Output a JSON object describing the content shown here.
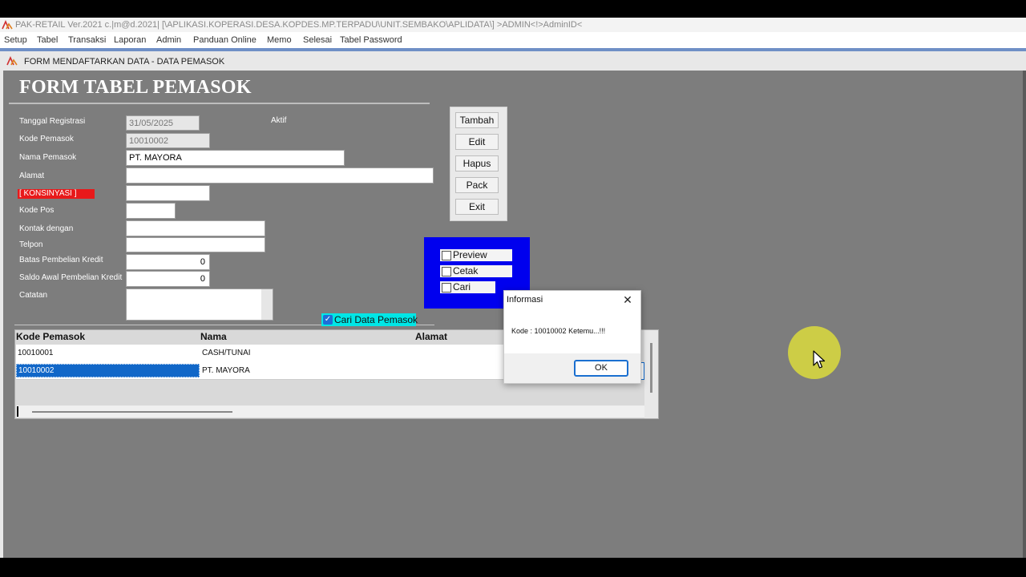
{
  "window": {
    "title": "PAK-RETAIL Ver.2021 c.|m@d.2021| [\\APLIKASI.KOPERASI.DESA.KOPDES.MP.TERPADU\\UNIT.SEMBAKO\\APLIDATA\\] >ADMIN<!>AdminID<"
  },
  "menubar": {
    "items": [
      "Setup",
      "Tabel",
      "Transaksi",
      "Laporan",
      "Admin",
      "Panduan Online",
      "Memo",
      "Selesai",
      "Tabel Password"
    ]
  },
  "form": {
    "window_caption": "FORM MENDAFTARKAN DATA - DATA PEMASOK",
    "heading": "FORM TABEL PEMASOK",
    "status_text": "Aktif",
    "fields": {
      "tanggal": {
        "label": "Tanggal Registrasi",
        "value": "31/05/2025"
      },
      "kode": {
        "label": "Kode Pemasok",
        "value": "10010002"
      },
      "nama": {
        "label": "Nama Pemasok",
        "value": "PT. MAYORA"
      },
      "alamat": {
        "label": "Alamat",
        "value": ""
      },
      "konsinyasi": {
        "label": "[ KONSINYASI ]",
        "value": ""
      },
      "kodepos": {
        "label": "Kode Pos",
        "value": ""
      },
      "kontak": {
        "label": "Kontak dengan",
        "value": ""
      },
      "telpon": {
        "label": "Telpon",
        "value": ""
      },
      "batas": {
        "label": "Batas Pembelian Kredit",
        "value": "0"
      },
      "saldo": {
        "label": "Saldo Awal Pembelian Kredit",
        "value": "0"
      },
      "catatan": {
        "label": "Catatan",
        "value": ""
      }
    }
  },
  "buttons": {
    "tambah": "Tambah",
    "edit": "Edit",
    "hapus": "Hapus",
    "pack": "Pack",
    "exit": "Exit"
  },
  "options": {
    "preview": "Preview",
    "cetak": "Cetak",
    "cari": "Cari",
    "cari_data": "Cari Data Pemasok"
  },
  "grid": {
    "columns": [
      "Kode Pemasok",
      "Nama",
      "Alamat"
    ],
    "rows": [
      {
        "kode": "10010001",
        "nama": "CASH/TUNAI",
        "alamat": ""
      },
      {
        "kode": "10010002",
        "nama": "PT. MAYORA",
        "alamat": ""
      }
    ]
  },
  "dialog": {
    "title": "Informasi",
    "message": "Kode : 10010002 Ketemu...!!!",
    "ok_label": "OK"
  },
  "colors": {
    "desktop": "#7d7d7d",
    "konsinyasi_label": "#e8191a",
    "option_panel": "#0000ee",
    "cari_data_bg": "#00e6e6",
    "selection": "#1167c8",
    "cursor_highlight": "#dbdb3c"
  }
}
